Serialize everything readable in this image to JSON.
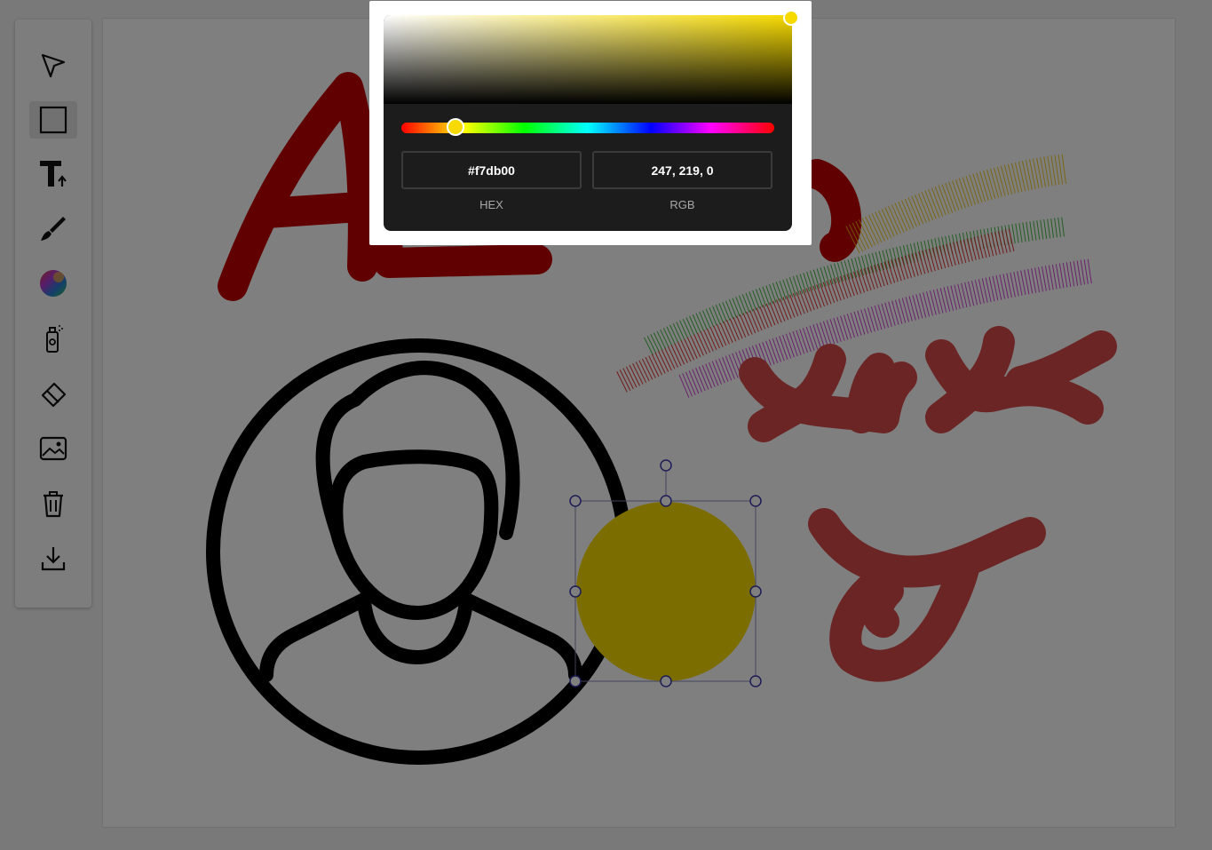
{
  "app": {
    "tools": [
      {
        "name": "select",
        "icon": "cursor-arrow-icon",
        "active": false
      },
      {
        "name": "rectangle",
        "icon": "square-icon",
        "active": true
      },
      {
        "name": "text",
        "icon": "text-icon",
        "active": false
      },
      {
        "name": "brush",
        "icon": "brush-icon",
        "active": false
      },
      {
        "name": "color",
        "icon": "color-wheel-icon",
        "active": false
      },
      {
        "name": "spray",
        "icon": "spray-can-icon",
        "active": false
      },
      {
        "name": "eraser",
        "icon": "eraser-icon",
        "active": false
      },
      {
        "name": "image",
        "icon": "image-icon",
        "active": false
      },
      {
        "name": "delete",
        "icon": "trash-icon",
        "active": false
      },
      {
        "name": "download",
        "icon": "download-icon",
        "active": false
      }
    ]
  },
  "color_picker": {
    "hex_value": "#f7db00",
    "rgb_value": "247, 219, 0",
    "hex_label": "HEX",
    "rgb_label": "RGB",
    "selected_color": "#f7db00"
  },
  "colors": {
    "stroke_red": "#c00000",
    "stroke_maroon": "#d84a4a",
    "circle_fill": "#f7db00",
    "selection": "#3a3aaa"
  }
}
